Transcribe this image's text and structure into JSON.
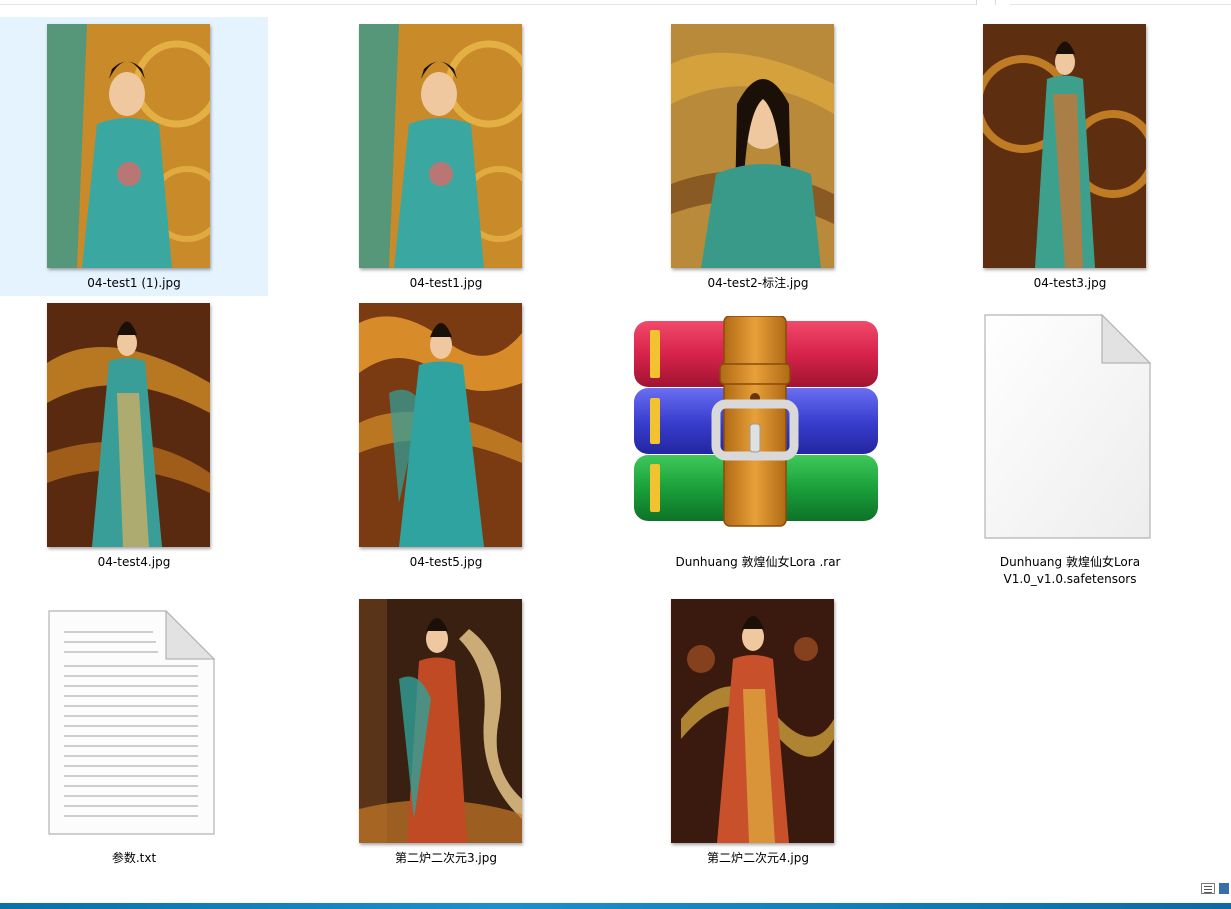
{
  "files": [
    {
      "name": "04-test1 (1).jpg",
      "kind": "photo",
      "palette": [
        "#c98a2a",
        "#2f9b96",
        "#7a3a14"
      ],
      "selected": true
    },
    {
      "name": "04-test1.jpg",
      "kind": "photo",
      "palette": [
        "#c98a2a",
        "#2f9b96",
        "#7a3a14"
      ],
      "selected": false
    },
    {
      "name": "04-test2-标注.jpg",
      "kind": "photo",
      "palette": [
        "#b98a3a",
        "#3a9a8a",
        "#6b3a18"
      ],
      "selected": false
    },
    {
      "name": "04-test3.jpg",
      "kind": "photo",
      "palette": [
        "#a4661e",
        "#3ca08c",
        "#5e2e10"
      ],
      "selected": false
    },
    {
      "name": "04-test4.jpg",
      "kind": "photo",
      "palette": [
        "#b06a1c",
        "#3a9e98",
        "#5a2a10"
      ],
      "selected": false
    },
    {
      "name": "04-test5.jpg",
      "kind": "photo",
      "palette": [
        "#d7902a",
        "#2fa3a0",
        "#7a3a12"
      ],
      "selected": false
    },
    {
      "name": "Dunhuang 敦煌仙女Lora .rar",
      "kind": "rar-archive",
      "selected": false
    },
    {
      "name": "Dunhuang 敦煌仙女Lora V1.0_v1.0.safetensors",
      "name_line1": "Dunhuang 敦煌仙女Lora",
      "name_line2": "V1.0_v1.0.safetensors",
      "kind": "blank-document",
      "selected": false
    },
    {
      "name": "参数.txt",
      "kind": "text-document",
      "selected": false
    },
    {
      "name": "第二炉二次元3.jpg",
      "kind": "photo",
      "palette": [
        "#3a2010",
        "#c04a24",
        "#2fa098"
      ],
      "selected": false
    },
    {
      "name": "第二炉二次元4.jpg",
      "kind": "photo",
      "palette": [
        "#3a1a0e",
        "#c8502a",
        "#e0b040"
      ],
      "selected": false
    }
  ],
  "colors": {
    "selection": "#e5f3ff",
    "taskbar": "#1c8fcf",
    "rar_red": "#d8234a",
    "rar_blue": "#3a3fd0",
    "rar_green": "#1aa03a",
    "rar_belt": "#d2892a"
  },
  "icons": {
    "details_view": "details-view-icon",
    "large_icons_view": "large-icons-view-icon"
  }
}
